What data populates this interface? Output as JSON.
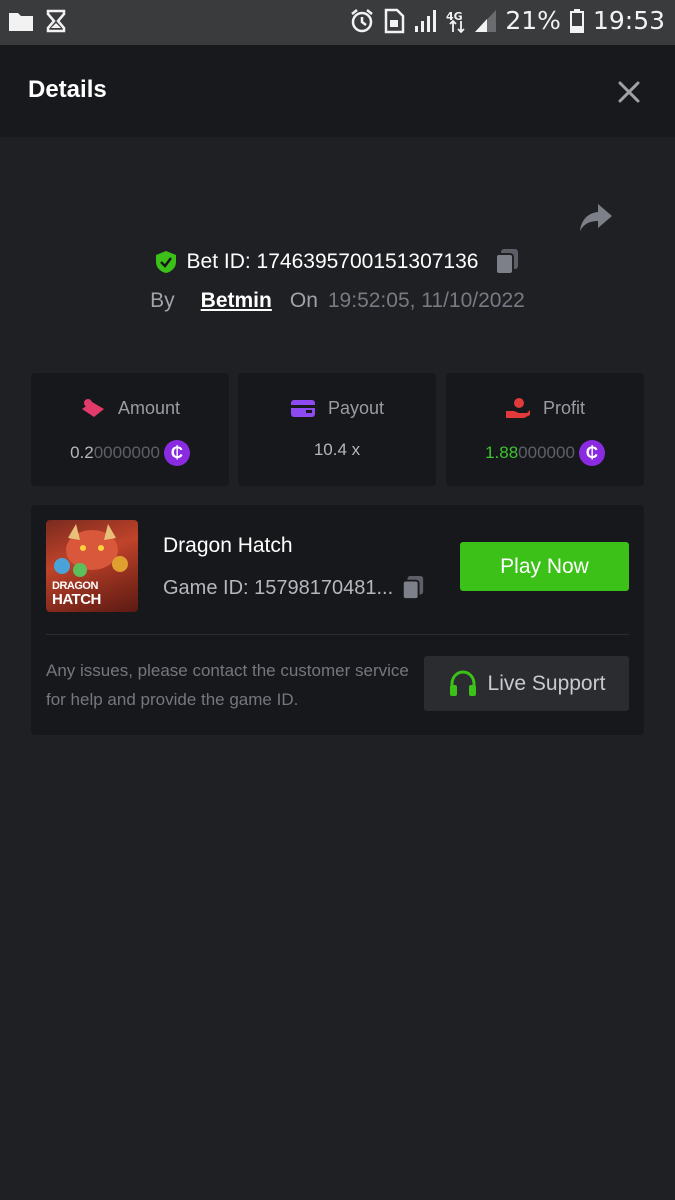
{
  "status_bar": {
    "battery_percent": "21%",
    "time": "19:53",
    "icons": [
      "folder-icon",
      "hourglass-icon",
      "alarm-icon",
      "sim-icon",
      "signal-icon",
      "4g-icon",
      "signal-icon",
      "battery-icon"
    ]
  },
  "header": {
    "title": "Details",
    "close_icon": "close-icon"
  },
  "bet": {
    "id_label": "Bet ID: 1746395700151307136",
    "by_label": "By",
    "user": "Betmin",
    "on_label": "On",
    "datetime": "19:52:05, 11/10/2022"
  },
  "stats": {
    "amount": {
      "label": "Amount",
      "value_main": "0.2",
      "value_dim": "0000000",
      "icon": "bet-chips-icon"
    },
    "payout": {
      "label": "Payout",
      "value": "10.4 x",
      "icon": "wallet-icon"
    },
    "profit": {
      "label": "Profit",
      "value_main": "1.88",
      "value_dim": "000000",
      "icon": "profit-hand-icon"
    },
    "coin_symbol": "₵"
  },
  "game": {
    "name": "Dragon Hatch",
    "id_label": "Game ID: 15798170481...",
    "thumb_line1": "DRAGON",
    "thumb_line2": "HATCH",
    "play_label": "Play Now"
  },
  "support": {
    "note": "Any issues, please contact the customer service for help and provide the game ID.",
    "button_label": "Live Support"
  },
  "colors": {
    "accent_green": "#3bc117",
    "coin_purple": "#8a2be2",
    "background": "#1f2023",
    "card": "#17181b"
  }
}
